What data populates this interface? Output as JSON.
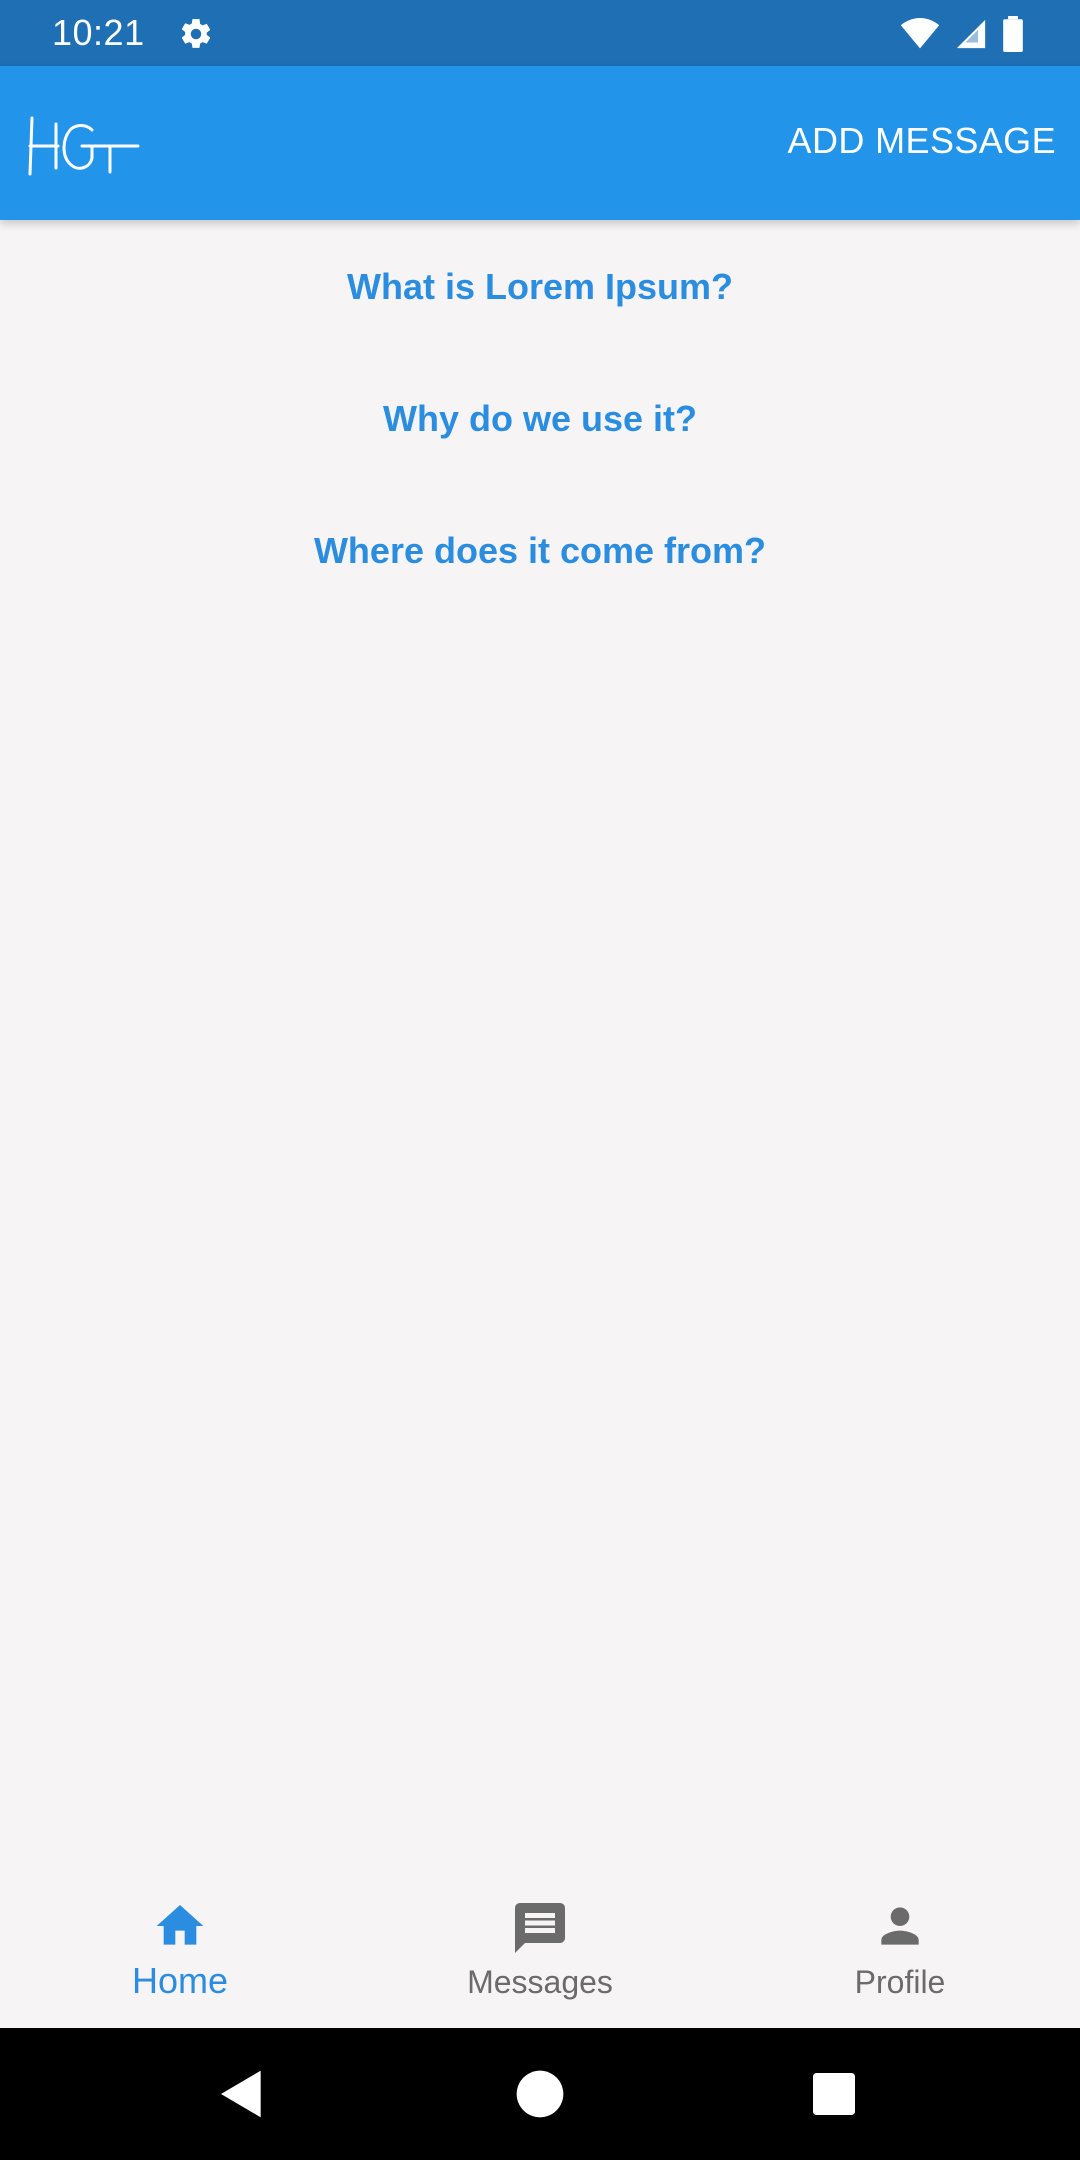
{
  "status_bar": {
    "time": "10:21",
    "icons": [
      "gear-icon",
      "wifi-icon",
      "signal-icon",
      "battery-icon"
    ]
  },
  "app_bar": {
    "logo_text": "HG",
    "action_label": "ADD MESSAGE",
    "color": "#2295ea"
  },
  "questions": [
    {
      "label": "What is Lorem Ipsum?"
    },
    {
      "label": "Why do we use it?"
    },
    {
      "label": "Where does it come from?"
    }
  ],
  "bottom_nav": {
    "items": [
      {
        "label": "Home",
        "icon": "home-icon",
        "active": true
      },
      {
        "label": "Messages",
        "icon": "message-icon",
        "active": false
      },
      {
        "label": "Profile",
        "icon": "person-icon",
        "active": false
      }
    ],
    "active_color": "#2b8de0",
    "inactive_color": "#6b6b6b"
  },
  "system_nav": {
    "buttons": [
      "back-icon",
      "home-circle-icon",
      "recents-icon"
    ]
  }
}
